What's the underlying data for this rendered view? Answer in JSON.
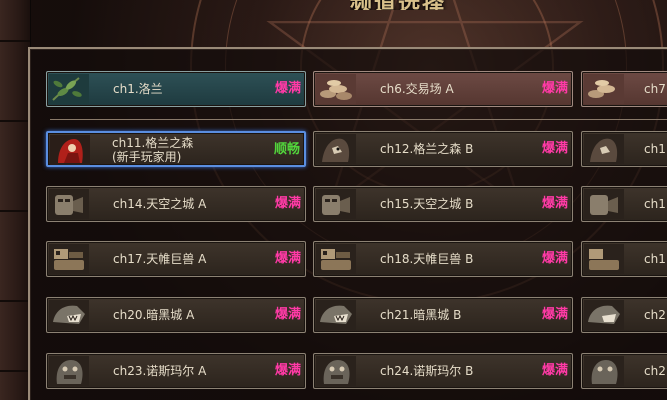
{
  "screen": {
    "title": "频道选择"
  },
  "colors": {
    "full_status": "#ff3aa6",
    "ok_status": "#52d63c",
    "selected_border": "#5a8ee0"
  },
  "channels": {
    "row1": [
      {
        "name": "ch1.洛兰",
        "status": "爆满",
        "icon": "vine-leaf-icon"
      },
      {
        "name": "ch6.交易场 A",
        "status": "爆满",
        "icon": "coin-pile-icon"
      },
      {
        "name": "ch7",
        "status": "",
        "icon": "coin-pile-icon"
      }
    ],
    "row2": [
      {
        "name_line1": "ch11.格兰之森",
        "name_line2": "(新手玩家用)",
        "status": "顺畅",
        "icon": "red-hood-icon"
      },
      {
        "name": "ch12.格兰之森 B",
        "status": "爆满",
        "icon": "hooded-monster-icon"
      },
      {
        "name": "ch1",
        "status": "",
        "icon": "hooded-monster-icon"
      }
    ],
    "row3": [
      {
        "name": "ch14.天空之城 A",
        "status": "爆满",
        "icon": "stone-golem-icon"
      },
      {
        "name": "ch15.天空之城 B",
        "status": "爆满",
        "icon": "stone-golem-icon"
      },
      {
        "name": "ch1",
        "status": "",
        "icon": "stone-golem-icon"
      }
    ],
    "row4": [
      {
        "name": "ch17.天帷巨兽 A",
        "status": "爆满",
        "icon": "machine-beast-icon"
      },
      {
        "name": "ch18.天帷巨兽 B",
        "status": "爆满",
        "icon": "machine-beast-icon"
      },
      {
        "name": "ch1",
        "status": "",
        "icon": "machine-beast-icon"
      }
    ],
    "row5": [
      {
        "name": "ch20.暗黑城 A",
        "status": "爆满",
        "icon": "dark-beast-icon"
      },
      {
        "name": "ch21.暗黑城 B",
        "status": "爆满",
        "icon": "dark-beast-icon"
      },
      {
        "name": "ch2",
        "status": "",
        "icon": "dark-beast-icon"
      }
    ],
    "row6": [
      {
        "name": "ch23.诺斯玛尔 A",
        "status": "爆满",
        "icon": "ghoul-icon"
      },
      {
        "name": "ch24.诺斯玛尔 B",
        "status": "爆满",
        "icon": "ghoul-icon"
      },
      {
        "name": "ch2",
        "status": "",
        "icon": "ghoul-icon"
      }
    ]
  }
}
